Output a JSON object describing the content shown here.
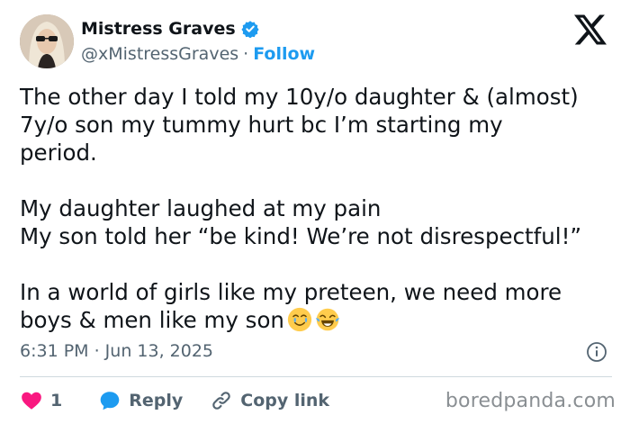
{
  "author": {
    "display_name": "Mistress Graves",
    "handle": "@xMistressGraves",
    "separator": "·",
    "follow_label": "Follow"
  },
  "tweet": {
    "text": "The other day I told my 10y/o daughter & (almost)\n7y/o son my tummy hurt bc I’m starting my\nperiod.\n\nMy daughter laughed at my pain\nMy son told her “be kind! We’re not disrespectful!”\n\nIn a world of girls like my preteen, we need more\nboys & men like my son",
    "emojis": [
      "teary-smiling-face-icon",
      "tears-of-joy-face-icon"
    ],
    "timestamp": "6:31 PM · Jun 13, 2025"
  },
  "actions": {
    "like_count": "1",
    "reply_label": "Reply",
    "copy_link_label": "Copy link"
  },
  "watermark": "boredpanda.com",
  "colors": {
    "accent": "#1d9bf0",
    "text": "#0f1419",
    "secondary": "#536471",
    "like": "#f91880",
    "divider": "#cfd9de",
    "watermark": "#8a8f93"
  }
}
